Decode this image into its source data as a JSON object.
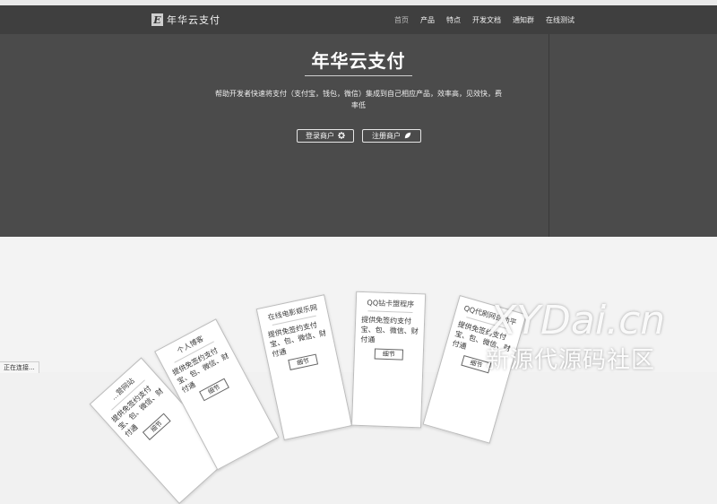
{
  "navbar": {
    "brand_logo": "E",
    "brand_name": "年华云支付",
    "items": [
      {
        "label": "首页",
        "active": true
      },
      {
        "label": "产品",
        "active": false
      },
      {
        "label": "特点",
        "active": false
      },
      {
        "label": "开发文档",
        "active": false
      },
      {
        "label": "通知群",
        "active": false
      },
      {
        "label": "在线测试",
        "active": false
      }
    ]
  },
  "hero": {
    "title": "年华云支付",
    "description": "帮助开发者快速将支付（支付宝，钱包，微信）集成到自己相应产品，效率高，见效快，费率低",
    "login_label": "登录商户",
    "register_label": "注册商户"
  },
  "cards": [
    {
      "title": "...营网站",
      "desc": "提供免签约支付宝、包、微信、财付通",
      "button": "细节"
    },
    {
      "title": "个人博客",
      "desc": "提供免签约支付宝、包、微信、财付通",
      "button": "细节"
    },
    {
      "title": "在线电影娱乐网",
      "desc": "提供免签约支付宝、包、微信、财付通",
      "button": "细节"
    },
    {
      "title": "QQ钻卡盟程序",
      "desc": "提供免签约支付宝、包、微信、财付通",
      "button": "细节"
    },
    {
      "title": "QQ代刷网自助平",
      "desc": "提供免签约支付宝、包、微信、财付通",
      "button": "细节"
    }
  ],
  "watermark": {
    "line1": "XYDai.cn",
    "line2": "新源代源码社区"
  },
  "status_bar": "正在连接..."
}
